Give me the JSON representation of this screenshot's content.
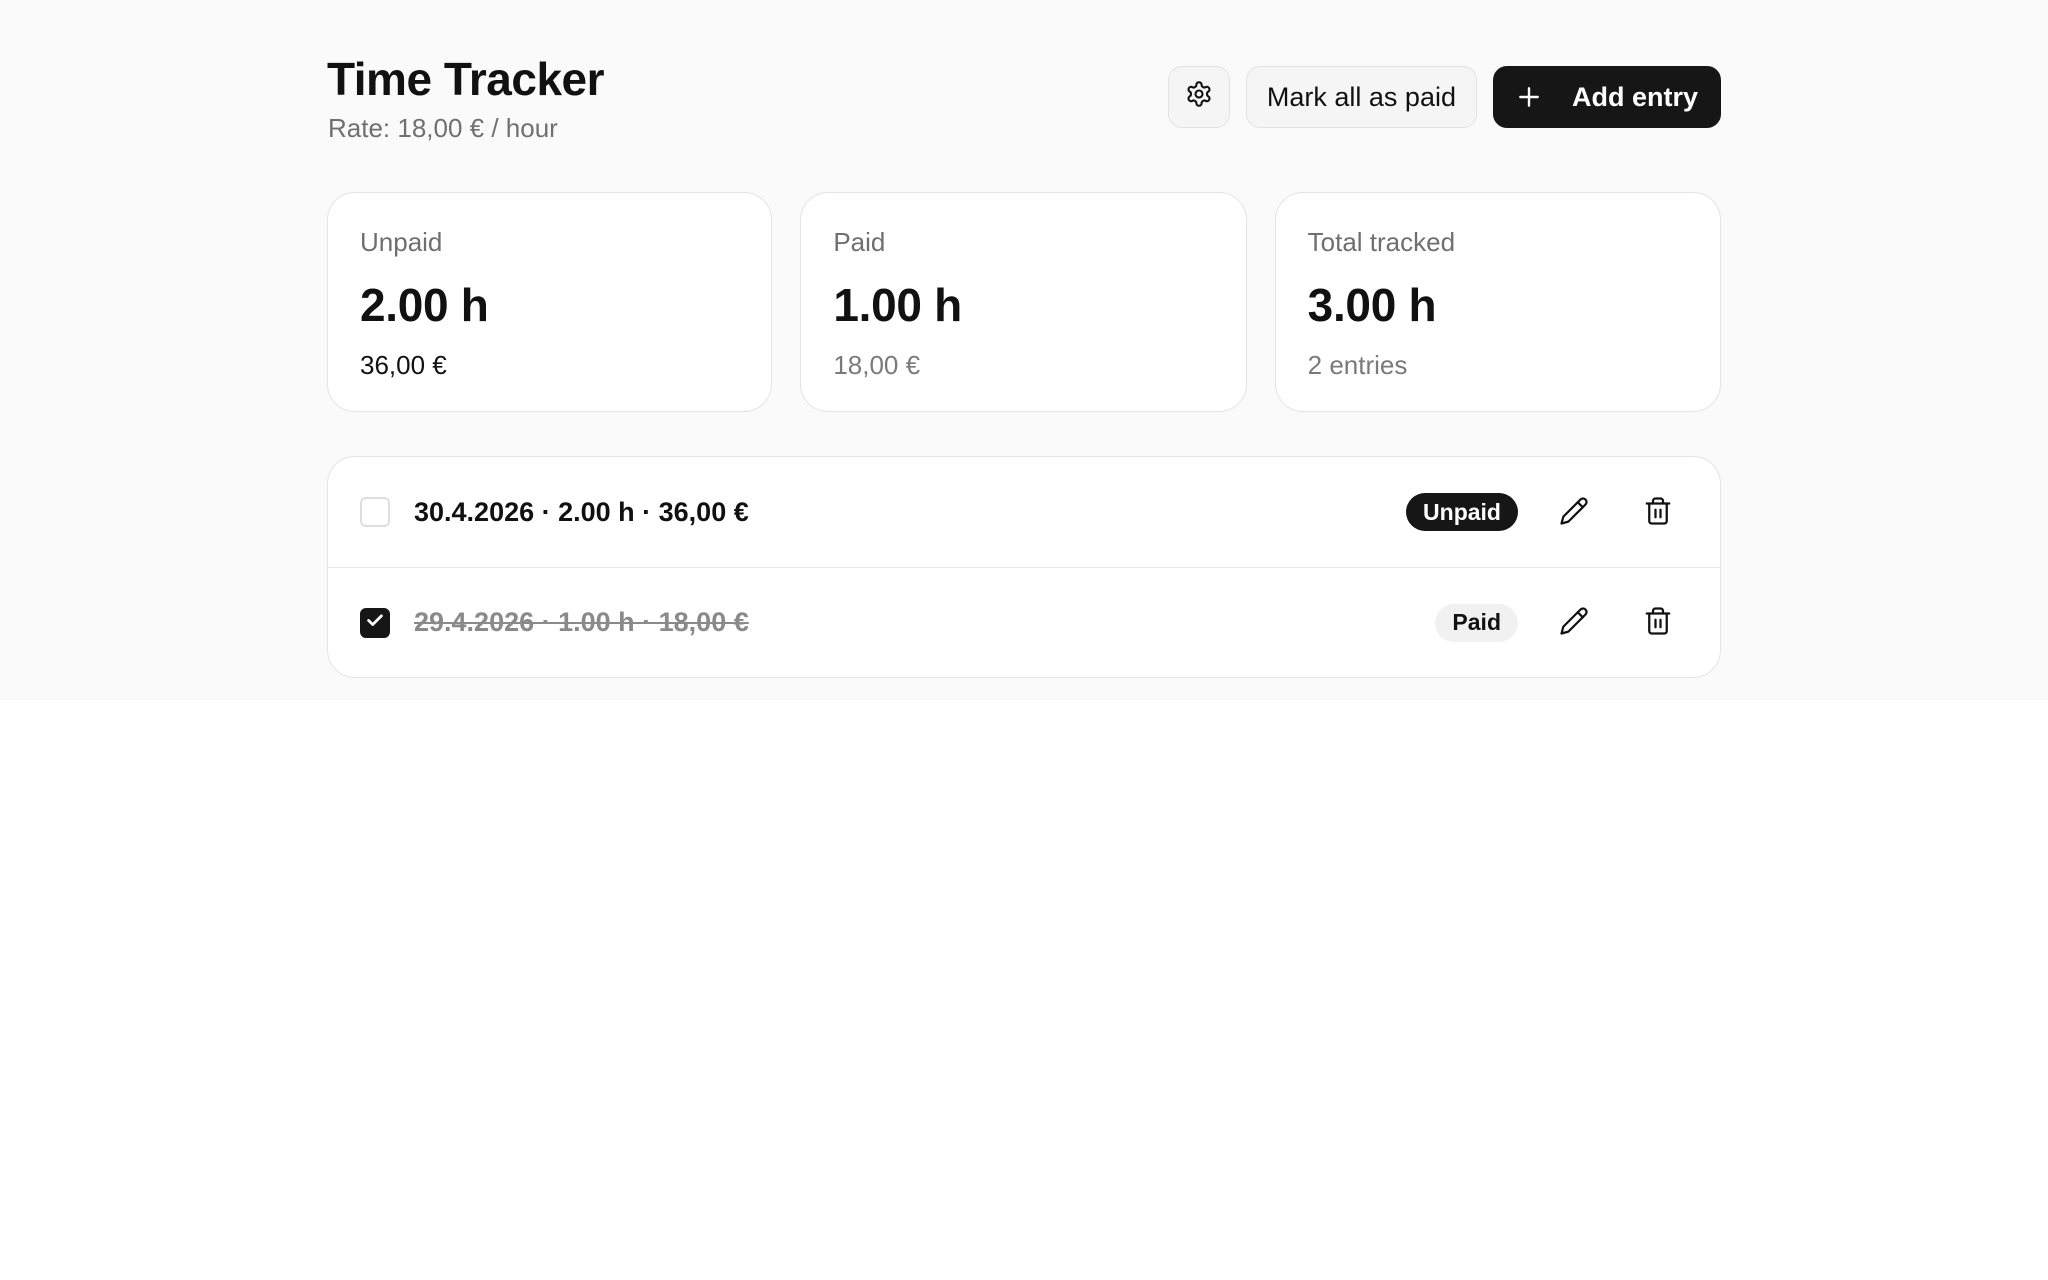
{
  "header": {
    "title": "Time Tracker",
    "rate": "Rate: 18,00 € / hour"
  },
  "actions": {
    "settings_icon": "gear-icon",
    "mark_all_label": "Mark all as paid",
    "add_entry_label": "Add entry",
    "add_icon": "plus-icon"
  },
  "stats": [
    {
      "label": "Unpaid",
      "value": "2.00 h",
      "sub": "36,00 €"
    },
    {
      "label": "Paid",
      "value": "1.00 h",
      "sub": "18,00 €"
    },
    {
      "label": "Total tracked",
      "value": "3.00 h",
      "sub": "2 entries"
    }
  ],
  "entries": [
    {
      "text": "30.4.2026 · 2.00 h · 36,00 €",
      "checked": false,
      "status": "Unpaid"
    },
    {
      "text": "29.4.2026 · 1.00 h · 18,00 €",
      "checked": true,
      "status": "Paid"
    }
  ],
  "colors": {
    "primary": "#161616",
    "muted_text": "#707070",
    "border": "#e4e4e4",
    "page_bg": "#fafafa"
  }
}
